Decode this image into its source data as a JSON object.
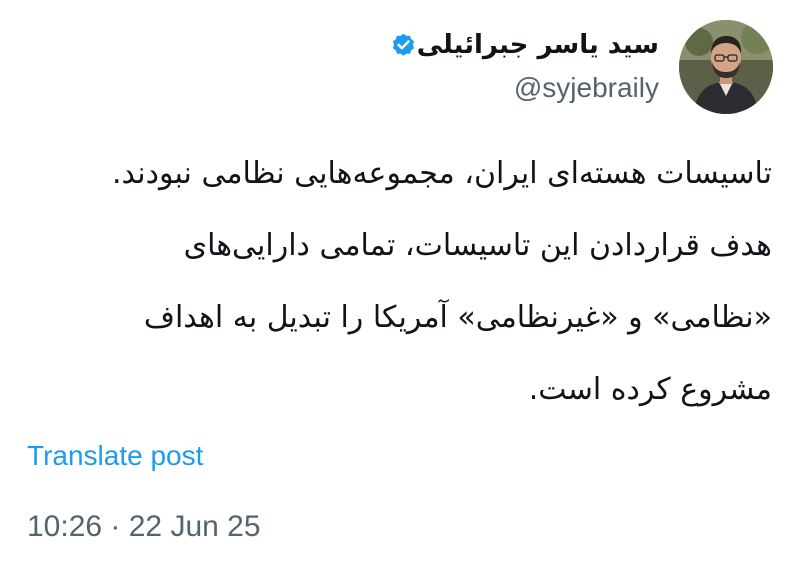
{
  "author": {
    "display_name": "سید یاسر جبرائیلی",
    "handle": "@syjebraily",
    "verified": true
  },
  "post": {
    "lines": [
      "تاسیسات هسته‌ای ایران، مجموعه‌هایی نظامی نبودند.",
      "هدف قراردادن این تاسیسات، تمامی دارایی‌های",
      "«نظامی» و «غیرنظامی» آمریکا را تبدیل به اهداف",
      "مشروع کرده است."
    ],
    "translate_label": "Translate post",
    "timestamp": "10:26 · 22 Jun 25"
  },
  "icons": {
    "more": "more-options-icon",
    "verified": "verified-badge-icon"
  },
  "colors": {
    "accent": "#1d9bf0",
    "text": "#0f1419",
    "secondary": "#536471"
  }
}
